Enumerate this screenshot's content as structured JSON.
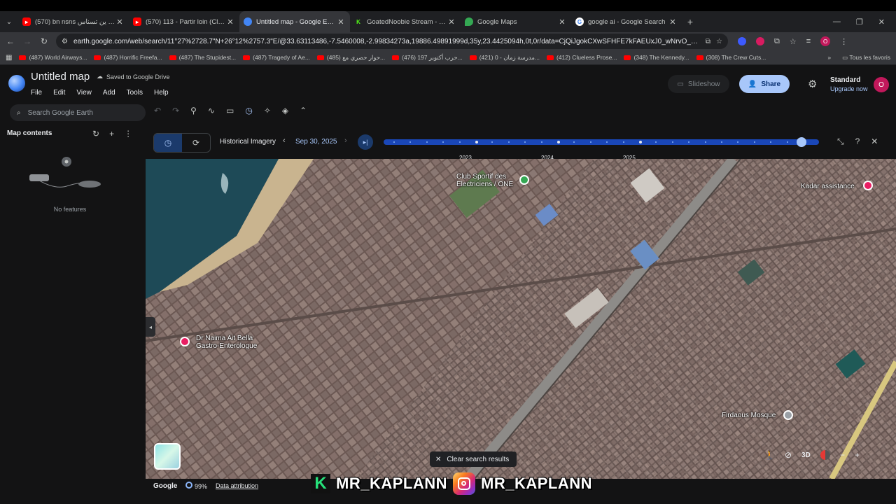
{
  "browser": {
    "tabs": [
      {
        "title": "(570) bn nsns ين تسناس - YouTub",
        "icon": "youtube-icon",
        "color": "#ff0000"
      },
      {
        "title": "(570) 113 - Partir loin (Clip offici",
        "icon": "youtube-icon",
        "color": "#ff0000"
      },
      {
        "title": "Untitled map - Google Earth",
        "icon": "earth-icon",
        "color": "#4285f4"
      },
      {
        "title": "GoatedNoobie Stream - Watch",
        "icon": "kick-icon",
        "color": "#53fc18"
      },
      {
        "title": "Google Maps",
        "icon": "maps-icon",
        "color": "#34a853"
      },
      {
        "title": "google ai - Google Search",
        "icon": "google-icon",
        "color": "#ffffff"
      }
    ],
    "url": "earth.google.com/web/search/11°27%2728.7\"N+26°12%2757.3\"E/@33.63113486,-7.5460008,-2.99834273a,19886.49891999d,35y,23.4425094h,0t,0r/data=CjQiJgokCXwSFHFE7kFAEUxJ0_wNrvO_GSA_dupnw1BAIW5qqqeWX0...",
    "bookmarks": [
      "(487) World Airways...",
      "(487) Horrific Freefa...",
      "(487) The Stupidest...",
      "(487) Tragedy of Ae...",
      "(485) حوار حصري مع...",
      "(476) حرب أكتوبر 197...",
      "(421) مدرسة زمان - 0...",
      "(412) Clueless Prose...",
      "(348) The Kennedy...",
      "(308) The Crew Cuts..."
    ],
    "all_bookmarks": "Tous les favoris"
  },
  "earth": {
    "title": "Untitled map",
    "saved": "Saved to Google Drive",
    "menus": [
      "File",
      "Edit",
      "View",
      "Add",
      "Tools",
      "Help"
    ],
    "search_placeholder": "Search Google Earth",
    "slideshow": "Slideshow",
    "share": "Share",
    "plan": "Standard",
    "upgrade": "Upgrade now",
    "avatar_letter": "O"
  },
  "left_panel": {
    "title": "Map contents",
    "empty": "No features"
  },
  "timeline": {
    "label": "Historical Imagery",
    "date": "Sep 30, 2025",
    "years": [
      "2023",
      "2024",
      "2025"
    ],
    "position": 0.96
  },
  "map": {
    "labels": {
      "club": "Club Sportif des Electriciens / ONE",
      "kadar": "Kadar assistance",
      "naima": "Dr Naima Ait Bella Gastro-Enterologue",
      "mosque": "Firdaous Mosque"
    },
    "clear": "Clear search results",
    "three_d": "3D"
  },
  "footer": {
    "logo": "Google",
    "percent": "99%",
    "attribution": "Data attribution"
  },
  "overlay": {
    "kick_name": "MR_KAPLANN",
    "insta_name": "MR_KAPLANN"
  }
}
